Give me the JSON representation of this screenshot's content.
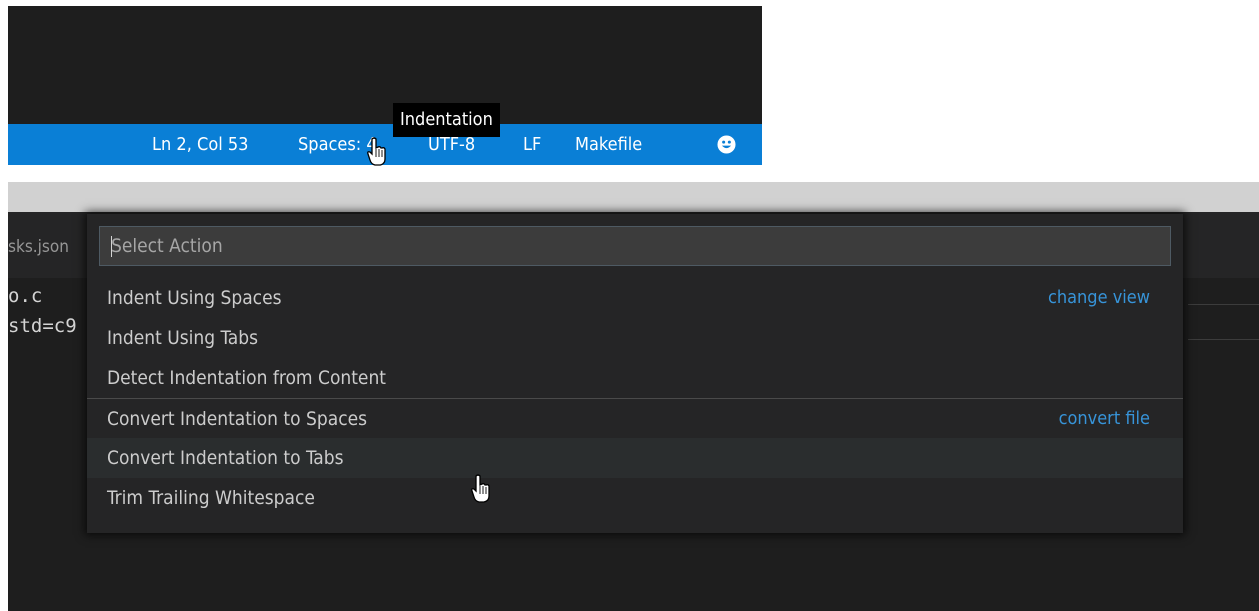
{
  "status_bar": {
    "line_col": "Ln 2, Col 53",
    "indentation": "Spaces: 4",
    "encoding": "UTF-8",
    "eol": "LF",
    "language": "Makefile",
    "feedback_icon": "smiley-icon",
    "tooltip": "Indentation",
    "color": "#0a7fd6"
  },
  "editor": {
    "tab_label": "sks.json",
    "code_lines": [
      "o.c",
      "std=c9"
    ]
  },
  "quick_pick": {
    "placeholder": "Select Action",
    "items": [
      {
        "label": "Indent Using Spaces",
        "group_label": "change view"
      },
      {
        "label": "Indent Using Tabs"
      },
      {
        "label": "Detect Indentation from Content"
      },
      {
        "label": "Convert Indentation to Spaces",
        "group_label": "convert file"
      },
      {
        "label": "Convert Indentation to Tabs"
      },
      {
        "label": "Trim Trailing Whitespace"
      }
    ]
  },
  "colors": {
    "editor_background": "#1e1e1e",
    "status_bar": "#0a7fd6",
    "group_label": "#3794d9"
  }
}
